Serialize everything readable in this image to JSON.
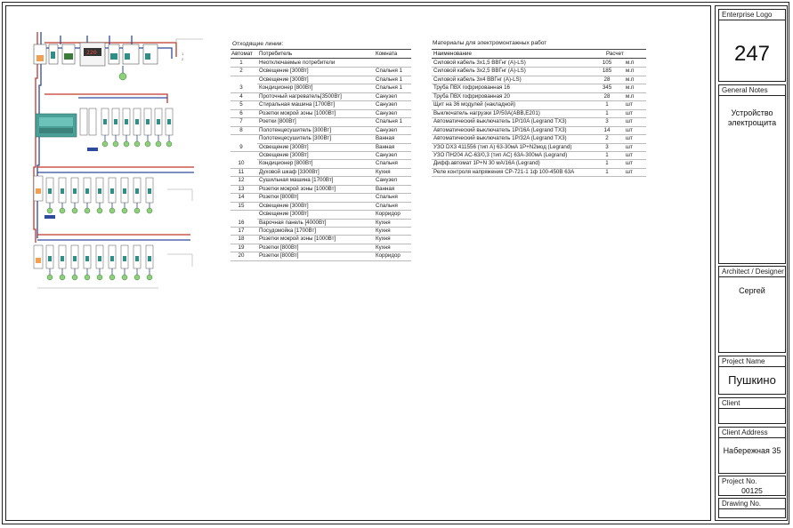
{
  "title_block": {
    "logo_caption": "Enterprise Logo",
    "logo_value": "247",
    "notes_caption": "General Notes",
    "notes_value": "Устройство электрощита",
    "designer_caption": "Architect / Designer",
    "designer_value": "Сергей",
    "project_caption": "Project Name",
    "project_value": "Пушкино",
    "client_caption": "Client",
    "address_caption": "Client Address",
    "address_value": "Набережная 35",
    "project_no_caption": "Project No.",
    "project_no_value": "00125",
    "drawing_no_caption": "Drawing No."
  },
  "lines_table": {
    "title": "Отходящие линии:",
    "headers": [
      "Автомат",
      "Потребитель",
      "Комната"
    ],
    "rows": [
      {
        "n": "1",
        "c": "Неотключаемые потребители",
        "r": ""
      },
      {
        "n": "2",
        "c": "Освещение [300Вт]",
        "r": "Спальня 1"
      },
      {
        "n": "",
        "c": "Освещение [300Вт]",
        "r": "Спальня 1"
      },
      {
        "n": "3",
        "c": "Кондиционер [800Вт]",
        "r": "Спальня 1"
      },
      {
        "n": "4",
        "c": "Проточный нагреватель[3500Вт]",
        "r": "Санузел"
      },
      {
        "n": "5",
        "c": "Стиральная машина [1700Вт]",
        "r": "Санузел"
      },
      {
        "n": "6",
        "c": "Розетки мокрой зоны [1000Вт]",
        "r": "Санузел"
      },
      {
        "n": "7",
        "c": "Роетки [800Вт]",
        "r": "Спальня 1"
      },
      {
        "n": "8",
        "c": "Полотенцесушитель [300Вт]",
        "r": "Санузел"
      },
      {
        "n": "",
        "c": "Полотенцесушитель [300Вт]",
        "r": "Ванная"
      },
      {
        "n": "9",
        "c": "Освещение [300Вт]",
        "r": "Ванная"
      },
      {
        "n": "",
        "c": "Освещение [300Вт]",
        "r": "Санузел"
      },
      {
        "n": "10",
        "c": "Кондиционер [800Вт]",
        "r": "Спальня"
      },
      {
        "n": "11",
        "c": "Духовой шкаф [3300Вт]",
        "r": "Кухня"
      },
      {
        "n": "12",
        "c": "Сушильная машина [1700Вт]",
        "r": "Санузел"
      },
      {
        "n": "13",
        "c": "Розетки мокрой зоны [1000Вт]",
        "r": "Ванная"
      },
      {
        "n": "14",
        "c": "Розетки [800Вт]",
        "r": "Спальня"
      },
      {
        "n": "15",
        "c": "Освещение [300Вт]",
        "r": "Спальня"
      },
      {
        "n": "",
        "c": "Освещение [300Вт]",
        "r": "Корридор"
      },
      {
        "n": "16",
        "c": "Варочная панель [4000Вт]",
        "r": "Кухня"
      },
      {
        "n": "17",
        "c": "Посудомойка [1700Вт]",
        "r": "Кухня"
      },
      {
        "n": "18",
        "c": "Розетки мокрой зоны [1000Вт]",
        "r": "Кухня"
      },
      {
        "n": "19",
        "c": "Розетки [800Вт]",
        "r": "Кухня"
      },
      {
        "n": "20",
        "c": "Розетки [800Вт]",
        "r": "Корридор"
      }
    ]
  },
  "materials_table": {
    "title": "Материалы для электромонтажных работ",
    "headers": [
      "Наименование",
      "Расчет"
    ],
    "rows": [
      {
        "name": "Силовой кабель 3х1,5 ВВГнг (А)-LS)",
        "qty": "105",
        "unit": "м.п"
      },
      {
        "name": "Силовой кабель 3х2,5 ВВГнг (А)-LS)",
        "qty": "185",
        "unit": "м.п"
      },
      {
        "name": "Силовой кабель 3х4 ВВГнг (А)-LS)",
        "qty": "28",
        "unit": "м.п"
      },
      {
        "name": "Труба ПВХ гофрированная 16",
        "qty": "345",
        "unit": "м.п"
      },
      {
        "name": "Труба ПВХ гофрированная 20",
        "qty": "28",
        "unit": "м.п"
      },
      {
        "name": "Щит на 36 модулей (накладной)",
        "qty": "1",
        "unit": "шт"
      },
      {
        "name": "Выключатель нагрузки 1P/50A(ABB,E201)",
        "qty": "1",
        "unit": "шт"
      },
      {
        "name": "Автоматический выключатель 1P/10A (Legrand TX3)",
        "qty": "3",
        "unit": "шт"
      },
      {
        "name": "Автоматический выключатель 1P/16A (Legrand TX3)",
        "qty": "14",
        "unit": "шт"
      },
      {
        "name": "Автоматический выключатель 1P/32A (Legrand TX3)",
        "qty": "2",
        "unit": "шт"
      },
      {
        "name": "УЗО DX3 411556 (тип A) 63-30мA 1P+N2мод (Legrand)",
        "qty": "3",
        "unit": "шт"
      },
      {
        "name": "УЗО ПН204 AC-63/0,3 (тип AC) 63A-300мA (Legrand)",
        "qty": "1",
        "unit": "шт"
      },
      {
        "name": "Дифф.автомат 1P+N 30 мA/16A (Legrand)",
        "qty": "1",
        "unit": "шт"
      },
      {
        "name": "Реле контроля напряжения CP-721-1 1ф 100-450В 63A",
        "qty": "1",
        "unit": "шт"
      }
    ]
  },
  "diagram": {
    "row1_small_labels": [
      "1",
      "2"
    ],
    "colors": {
      "phase": "#c0392b",
      "neutral": "#2e4a9e",
      "earth": "#3c7a3c",
      "lamp": "#8fd07a",
      "meter": "#2f8f86"
    }
  }
}
